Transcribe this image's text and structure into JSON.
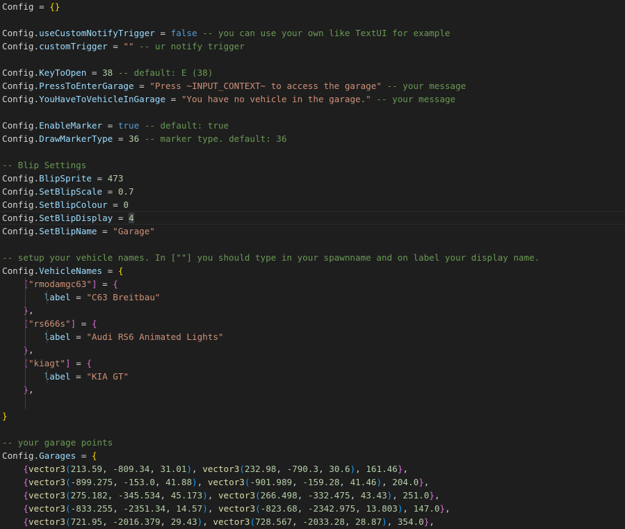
{
  "editor": {
    "language": "lua",
    "theme": "dark",
    "colors": {
      "background": "#1e1e1e",
      "identifier": "#9cdcfe",
      "plain": "#d4d4d4",
      "string": "#ce9178",
      "number": "#b5cea8",
      "keyword": "#569cd6",
      "comment": "#6a9955",
      "function": "#dcdcaa",
      "bracket_level_1": "#ffd700",
      "bracket_level_2": "#da70d6",
      "bracket_level_3": "#179fff"
    },
    "lines": [
      [
        [
          "plain",
          "Config = "
        ],
        [
          "brace1",
          "{}"
        ]
      ],
      [],
      [
        [
          "plain",
          "Config."
        ],
        [
          "ident",
          "useCustomNotifyTrigger"
        ],
        [
          "plain",
          " = "
        ],
        [
          "keyword",
          "false"
        ],
        [
          "plain",
          " "
        ],
        [
          "comment",
          "-- you can use your own like TextUI for example"
        ]
      ],
      [
        [
          "plain",
          "Config."
        ],
        [
          "ident",
          "customTrigger"
        ],
        [
          "plain",
          " = "
        ],
        [
          "string",
          "\"\""
        ],
        [
          "plain",
          " "
        ],
        [
          "comment",
          "-- ur notify trigger"
        ]
      ],
      [],
      [
        [
          "plain",
          "Config."
        ],
        [
          "ident",
          "KeyToOpen"
        ],
        [
          "plain",
          " = "
        ],
        [
          "number",
          "38"
        ],
        [
          "plain",
          " "
        ],
        [
          "comment",
          "-- default: E (38)"
        ]
      ],
      [
        [
          "plain",
          "Config."
        ],
        [
          "ident",
          "PressToEnterGarage"
        ],
        [
          "plain",
          " = "
        ],
        [
          "string",
          "\"Press ~INPUT_CONTEXT~ to access the garage\""
        ],
        [
          "plain",
          " "
        ],
        [
          "comment",
          "-- your message"
        ]
      ],
      [
        [
          "plain",
          "Config."
        ],
        [
          "ident",
          "YouHaveToVehicleInGarage"
        ],
        [
          "plain",
          " = "
        ],
        [
          "string",
          "\"You have no vehicle in the garage.\""
        ],
        [
          "plain",
          " "
        ],
        [
          "comment",
          "-- your message"
        ]
      ],
      [],
      [
        [
          "plain",
          "Config."
        ],
        [
          "ident",
          "EnableMarker"
        ],
        [
          "plain",
          " = "
        ],
        [
          "keyword",
          "true"
        ],
        [
          "plain",
          " "
        ],
        [
          "comment",
          "-- default: true"
        ]
      ],
      [
        [
          "plain",
          "Config."
        ],
        [
          "ident",
          "DrawMarkerType"
        ],
        [
          "plain",
          " = "
        ],
        [
          "number",
          "36"
        ],
        [
          "plain",
          " "
        ],
        [
          "comment",
          "-- marker type. default: 36"
        ]
      ],
      [],
      [
        [
          "comment",
          "-- Blip Settings"
        ]
      ],
      [
        [
          "plain",
          "Config."
        ],
        [
          "ident",
          "BlipSprite"
        ],
        [
          "plain",
          " = "
        ],
        [
          "number",
          "473"
        ]
      ],
      [
        [
          "plain",
          "Config."
        ],
        [
          "ident",
          "SetBlipScale"
        ],
        [
          "plain",
          " = "
        ],
        [
          "number",
          "0.7"
        ]
      ],
      [
        [
          "plain",
          "Config."
        ],
        [
          "ident",
          "SetBlipColour"
        ],
        [
          "plain",
          " = "
        ],
        [
          "number",
          "0"
        ]
      ],
      [
        [
          "plain",
          "Config."
        ],
        [
          "ident",
          "SetBlipDisplay"
        ],
        [
          "plain",
          " = "
        ],
        [
          "number",
          "4"
        ]
      ],
      [
        [
          "plain",
          "Config."
        ],
        [
          "ident",
          "SetBlipName"
        ],
        [
          "plain",
          " = "
        ],
        [
          "string",
          "\"Garage\""
        ]
      ],
      [],
      [
        [
          "comment",
          "-- setup your vehicle names. In [\"\"] you should type in your spawnname and on label your display name."
        ]
      ],
      [
        [
          "plain",
          "Config."
        ],
        [
          "ident",
          "VehicleNames"
        ],
        [
          "plain",
          " = "
        ],
        [
          "brace1",
          "{"
        ]
      ],
      [
        [
          "plain",
          "    "
        ],
        [
          "brace2",
          "["
        ],
        [
          "string",
          "\"rmodamgc63\""
        ],
        [
          "brace2",
          "]"
        ],
        [
          "plain",
          " = "
        ],
        [
          "brace2",
          "{"
        ]
      ],
      [
        [
          "plain",
          "        "
        ],
        [
          "ident",
          "label"
        ],
        [
          "plain",
          " = "
        ],
        [
          "string",
          "\"C63 Breitbau\""
        ]
      ],
      [
        [
          "plain",
          "    "
        ],
        [
          "brace2",
          "}"
        ],
        [
          "plain",
          ","
        ]
      ],
      [
        [
          "plain",
          "    "
        ],
        [
          "brace2",
          "["
        ],
        [
          "string",
          "\"rs666s\""
        ],
        [
          "brace2",
          "]"
        ],
        [
          "plain",
          " = "
        ],
        [
          "brace2",
          "{"
        ]
      ],
      [
        [
          "plain",
          "        "
        ],
        [
          "ident",
          "label"
        ],
        [
          "plain",
          " = "
        ],
        [
          "string",
          "\"Audi RS6 Animated Lights\""
        ]
      ],
      [
        [
          "plain",
          "    "
        ],
        [
          "brace2",
          "}"
        ],
        [
          "plain",
          ","
        ]
      ],
      [
        [
          "plain",
          "    "
        ],
        [
          "brace2",
          "["
        ],
        [
          "string",
          "\"kiagt\""
        ],
        [
          "brace2",
          "]"
        ],
        [
          "plain",
          " = "
        ],
        [
          "brace2",
          "{"
        ]
      ],
      [
        [
          "plain",
          "        "
        ],
        [
          "ident",
          "label"
        ],
        [
          "plain",
          " = "
        ],
        [
          "string",
          "\"KIA GT\""
        ]
      ],
      [
        [
          "plain",
          "    "
        ],
        [
          "brace2",
          "}"
        ],
        [
          "plain",
          ","
        ]
      ],
      [],
      [
        [
          "brace1",
          "}"
        ]
      ],
      [],
      [
        [
          "comment",
          "-- your garage points"
        ]
      ],
      [
        [
          "plain",
          "Config."
        ],
        [
          "ident",
          "Garages"
        ],
        [
          "plain",
          " = "
        ],
        [
          "brace1",
          "{"
        ]
      ],
      [
        [
          "plain",
          "    "
        ],
        [
          "brace2",
          "{"
        ],
        [
          "func",
          "vector3"
        ],
        [
          "brace3",
          "("
        ],
        [
          "number",
          "213.59"
        ],
        [
          "plain",
          ", "
        ],
        [
          "number",
          "-809.34"
        ],
        [
          "plain",
          ", "
        ],
        [
          "number",
          "31.01"
        ],
        [
          "brace3",
          ")"
        ],
        [
          "plain",
          ", "
        ],
        [
          "func",
          "vector3"
        ],
        [
          "brace3",
          "("
        ],
        [
          "number",
          "232.98"
        ],
        [
          "plain",
          ", "
        ],
        [
          "number",
          "-790.3"
        ],
        [
          "plain",
          ", "
        ],
        [
          "number",
          "30.6"
        ],
        [
          "brace3",
          ")"
        ],
        [
          "plain",
          ", "
        ],
        [
          "number",
          "161.46"
        ],
        [
          "brace2",
          "}"
        ],
        [
          "plain",
          ","
        ]
      ],
      [
        [
          "plain",
          "    "
        ],
        [
          "brace2",
          "{"
        ],
        [
          "func",
          "vector3"
        ],
        [
          "brace3",
          "("
        ],
        [
          "number",
          "-899.275"
        ],
        [
          "plain",
          ", "
        ],
        [
          "number",
          "-153.0"
        ],
        [
          "plain",
          ", "
        ],
        [
          "number",
          "41.88"
        ],
        [
          "brace3",
          ")"
        ],
        [
          "plain",
          ", "
        ],
        [
          "func",
          "vector3"
        ],
        [
          "brace3",
          "("
        ],
        [
          "number",
          "-901.989"
        ],
        [
          "plain",
          ", "
        ],
        [
          "number",
          "-159.28"
        ],
        [
          "plain",
          ", "
        ],
        [
          "number",
          "41.46"
        ],
        [
          "brace3",
          ")"
        ],
        [
          "plain",
          ", "
        ],
        [
          "number",
          "204.0"
        ],
        [
          "brace2",
          "}"
        ],
        [
          "plain",
          ","
        ]
      ],
      [
        [
          "plain",
          "    "
        ],
        [
          "brace2",
          "{"
        ],
        [
          "func",
          "vector3"
        ],
        [
          "brace3",
          "("
        ],
        [
          "number",
          "275.182"
        ],
        [
          "plain",
          ", "
        ],
        [
          "number",
          "-345.534"
        ],
        [
          "plain",
          ", "
        ],
        [
          "number",
          "45.173"
        ],
        [
          "brace3",
          ")"
        ],
        [
          "plain",
          ", "
        ],
        [
          "func",
          "vector3"
        ],
        [
          "brace3",
          "("
        ],
        [
          "number",
          "266.498"
        ],
        [
          "plain",
          ", "
        ],
        [
          "number",
          "-332.475"
        ],
        [
          "plain",
          ", "
        ],
        [
          "number",
          "43.43"
        ],
        [
          "brace3",
          ")"
        ],
        [
          "plain",
          ", "
        ],
        [
          "number",
          "251.0"
        ],
        [
          "brace2",
          "}"
        ],
        [
          "plain",
          ","
        ]
      ],
      [
        [
          "plain",
          "    "
        ],
        [
          "brace2",
          "{"
        ],
        [
          "func",
          "vector3"
        ],
        [
          "brace3",
          "("
        ],
        [
          "number",
          "-833.255"
        ],
        [
          "plain",
          ", "
        ],
        [
          "number",
          "-2351.34"
        ],
        [
          "plain",
          ", "
        ],
        [
          "number",
          "14.57"
        ],
        [
          "brace3",
          ")"
        ],
        [
          "plain",
          ", "
        ],
        [
          "func",
          "vector3"
        ],
        [
          "brace3",
          "("
        ],
        [
          "number",
          "-823.68"
        ],
        [
          "plain",
          ", "
        ],
        [
          "number",
          "-2342.975"
        ],
        [
          "plain",
          ", "
        ],
        [
          "number",
          "13.803"
        ],
        [
          "brace3",
          ")"
        ],
        [
          "plain",
          ", "
        ],
        [
          "number",
          "147.0"
        ],
        [
          "brace2",
          "}"
        ],
        [
          "plain",
          ","
        ]
      ],
      [
        [
          "plain",
          "    "
        ],
        [
          "brace2",
          "{"
        ],
        [
          "func",
          "vector3"
        ],
        [
          "brace3",
          "("
        ],
        [
          "number",
          "721.95"
        ],
        [
          "plain",
          ", "
        ],
        [
          "number",
          "-2016.379"
        ],
        [
          "plain",
          ", "
        ],
        [
          "number",
          "29.43"
        ],
        [
          "brace3",
          ")"
        ],
        [
          "plain",
          ", "
        ],
        [
          "func",
          "vector3"
        ],
        [
          "brace3",
          "("
        ],
        [
          "number",
          "728.567"
        ],
        [
          "plain",
          ", "
        ],
        [
          "number",
          "-2033.28"
        ],
        [
          "plain",
          ", "
        ],
        [
          "number",
          "28.87"
        ],
        [
          "brace3",
          ")"
        ],
        [
          "plain",
          ", "
        ],
        [
          "number",
          "354.0"
        ],
        [
          "brace2",
          "}"
        ],
        [
          "plain",
          ","
        ]
      ]
    ]
  }
}
